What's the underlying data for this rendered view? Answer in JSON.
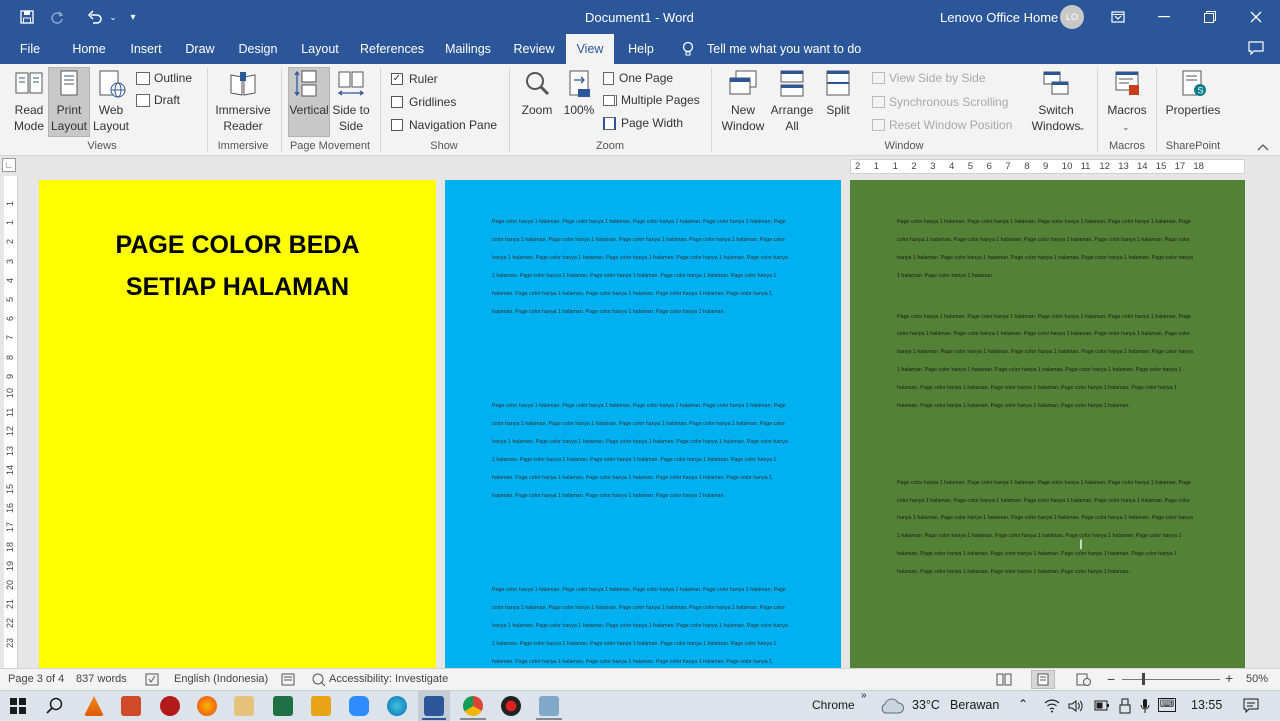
{
  "title_bar": {
    "document_title": "Document1  -  Word",
    "account_name": "Lenovo Office Home",
    "avatar_initials": "LO"
  },
  "tabs": [
    "File",
    "Home",
    "Insert",
    "Draw",
    "Design",
    "Layout",
    "References",
    "Mailings",
    "Review",
    "View",
    "Help"
  ],
  "active_tab": "View",
  "tell_me_placeholder": "Tell me what you want to do",
  "ribbon": {
    "views": {
      "read_mode": "Read Mode",
      "print_layout": "Print Layout",
      "web_layout": "Web Layout",
      "outline": "Outline",
      "draft": "Draft",
      "group": "Views"
    },
    "immersive": {
      "reader": "Immersive Reader",
      "group": "Immersive"
    },
    "page_movement": {
      "vertical": "Vertical",
      "side_to_side": "Side to Side",
      "group": "Page Movement"
    },
    "show": {
      "ruler": "Ruler",
      "ruler_checked": true,
      "gridlines": "Gridlines",
      "navigation_pane": "Navigation Pane",
      "group": "Show"
    },
    "zoom": {
      "zoom": "Zoom",
      "percent100": "100%",
      "one_page": "One Page",
      "multiple_pages": "Multiple Pages",
      "page_width": "Page Width",
      "group": "Zoom"
    },
    "window": {
      "new_window": "New Window",
      "arrange_all": "Arrange All",
      "split": "Split",
      "view_side_by_side": "View Side by Side",
      "synchronous_scrolling": "Synchronous Scrolling",
      "reset_window_position": "Reset Window Position",
      "switch_windows": "Switch Windows",
      "group": "Window"
    },
    "macros": {
      "macros": "Macros",
      "group": "Macros"
    },
    "sharepoint": {
      "properties": "Properties",
      "group": "SharePoint"
    }
  },
  "ruler_labels": [
    "2",
    "1",
    "1",
    "2",
    "3",
    "4",
    "5",
    "6",
    "7",
    "8",
    "9",
    "10",
    "11",
    "12",
    "13",
    "14",
    "15",
    "17",
    "18"
  ],
  "vertical_ruler_labels": [
    "1",
    "1",
    "2",
    "3",
    "4",
    "5",
    "6",
    "7",
    "8",
    "9",
    "10",
    "11",
    "12",
    "13",
    "14",
    "15",
    "16",
    "17",
    "18",
    "19",
    "20",
    "21",
    "22",
    "23"
  ],
  "pages": [
    {
      "color": "#ffff00",
      "heading_line1": "PAGE COLOR BEDA",
      "heading_line2": "SETIAP HALAMAN"
    },
    {
      "color": "#00b0f0",
      "text_color": "#333333"
    },
    {
      "color": "#538135",
      "text_color": "#1a1a1a"
    }
  ],
  "body_paragraph": "Page color hanya 1 halaman.",
  "status": {
    "page": "Page 3 of 4",
    "words": "837 words",
    "language": "English (Indonesia)",
    "accessibility": "Accessibility: Investigate",
    "zoom": "50%"
  },
  "taskbar": {
    "chrome_label": "Chrome",
    "temperature": "33°C",
    "weather": "Berawan",
    "time": "13:55"
  }
}
